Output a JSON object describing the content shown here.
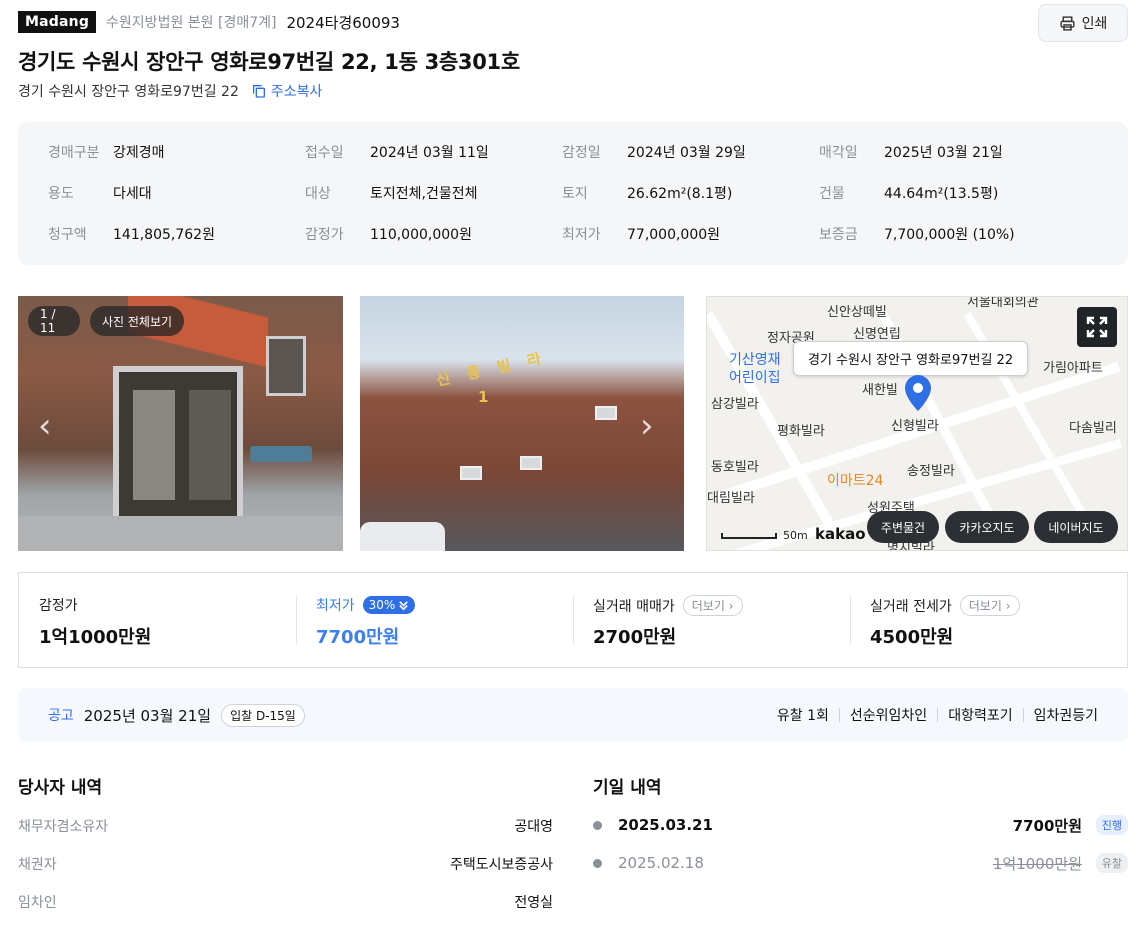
{
  "header": {
    "logo": "Madang",
    "court": "수원지방법원 본원 [경매7계]",
    "case_number": "2024타경60093",
    "print_label": "인쇄"
  },
  "property": {
    "title": "경기도 수원시 장안구 영화로97번길 22, 1동 3층301호",
    "address": "경기 수원시 장안구 영화로97번길 22",
    "copy_label": "주소복사"
  },
  "info": [
    {
      "label": "경매구분",
      "value": "강제경매"
    },
    {
      "label": "접수일",
      "value": "2024년 03월 11일"
    },
    {
      "label": "감정일",
      "value": "2024년 03월 29일"
    },
    {
      "label": "매각일",
      "value": "2025년 03월 21일"
    },
    {
      "label": "용도",
      "value": "다세대"
    },
    {
      "label": "대상",
      "value": "토지전체,건물전체"
    },
    {
      "label": "토지",
      "value": "26.62m²(8.1평)"
    },
    {
      "label": "건물",
      "value": "44.64m²(13.5평)"
    },
    {
      "label": "청구액",
      "value": "141,805,762원"
    },
    {
      "label": "감정가",
      "value": "110,000,000원"
    },
    {
      "label": "최저가",
      "value": "77,000,000원"
    },
    {
      "label": "보증금",
      "value": "7,700,000원 (10%)"
    }
  ],
  "gallery": {
    "counter": "1 / 11",
    "view_all": "사진 전체보기",
    "photo2_sign": "신 흥 빌 라",
    "photo2_number": "1"
  },
  "map": {
    "tooltip": "경기 수원시 장안구 영화로97번길 22",
    "labels": {
      "l1": "신안상떼빌",
      "l2": "정자공원",
      "l3": "신명연립",
      "l4": "기산영재",
      "l5": "어린이집",
      "l6": "가림아파트",
      "l7": "새한빌",
      "l8": "삼강빌라",
      "l9": "평화빌라",
      "l10": "신형빌라",
      "l11": "다솜빌리",
      "l12": "동호빌라",
      "l13": "이마트24",
      "l14": "송정빌라",
      "l15": "대림빌라",
      "l16": "성원주택",
      "l17": "서울대회의관",
      "l18": "명지빌라"
    },
    "scale": "50m",
    "brand": "kakao",
    "btn_nearby": "주변물건",
    "btn_kakao": "카카오지도",
    "btn_naver": "네이버지도"
  },
  "prices": {
    "appraisal_label": "감정가",
    "appraisal_value": "1억1000만원",
    "minimum_label": "최저가",
    "minimum_pct": "30%",
    "minimum_value": "7700만원",
    "sale_label": "실거래 매매가",
    "sale_more": "더보기",
    "sale_value": "2700만원",
    "jeonse_label": "실거래 전세가",
    "jeonse_more": "더보기",
    "jeonse_value": "4500만원"
  },
  "notice": {
    "label": "공고",
    "date": "2025년 03월 21일",
    "dday": "입찰 D-15일",
    "tags": [
      "유찰 1회",
      "선순위임차인",
      "대항력포기",
      "임차권등기"
    ]
  },
  "parties": {
    "title": "당사자 내역",
    "rows": [
      {
        "key": "채무자겸소유자",
        "value": "공대영"
      },
      {
        "key": "채권자",
        "value": "주택도시보증공사"
      },
      {
        "key": "임차인",
        "value": "전영실"
      }
    ]
  },
  "history": {
    "title": "기일 내역",
    "rows": [
      {
        "date": "2025.03.21",
        "price": "7700만원",
        "status": "진행"
      },
      {
        "date": "2025.02.18",
        "price": "1억1000만원",
        "status": "유찰"
      }
    ]
  },
  "colors": {
    "accent": "#2f6fe6",
    "min_price": "#3d7ef0",
    "label_gray": "#8a8f99"
  }
}
